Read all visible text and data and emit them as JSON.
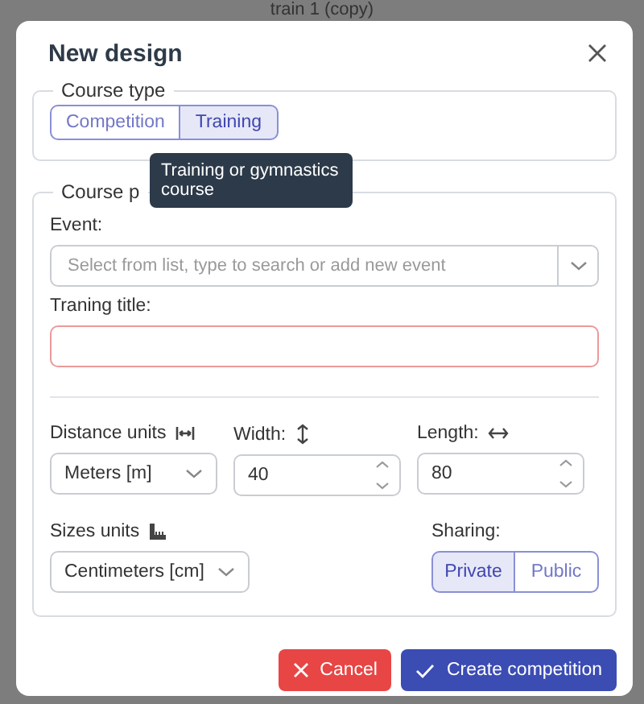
{
  "background": {
    "title": "train 1 (copy)"
  },
  "dialog": {
    "title": "New design",
    "course_type": {
      "legend": "Course type",
      "options": [
        {
          "label": "Competition",
          "selected": false
        },
        {
          "label": "Training",
          "selected": true
        }
      ],
      "tooltip": "Training or gymnastics course"
    },
    "course_panel": {
      "legend": "Course p",
      "event": {
        "label": "Event:",
        "placeholder": "Select from list, type to search or add new event"
      },
      "title_field": {
        "label": "Traning title:",
        "invalid": true
      },
      "distance_units": {
        "label": "Distance units",
        "value": "Meters [m]"
      },
      "width": {
        "label": "Width:",
        "value": "40"
      },
      "length": {
        "label": "Length:",
        "value": "80"
      },
      "sizes_units": {
        "label": "Sizes units",
        "value": "Centimeters [cm]"
      },
      "sharing": {
        "label": "Sharing:",
        "options": [
          {
            "label": "Private",
            "selected": true
          },
          {
            "label": "Public",
            "selected": false
          }
        ]
      }
    },
    "buttons": [
      {
        "label": "Cancel",
        "kind": "cancel"
      },
      {
        "label": "Create competition",
        "kind": "confirm"
      }
    ]
  }
}
